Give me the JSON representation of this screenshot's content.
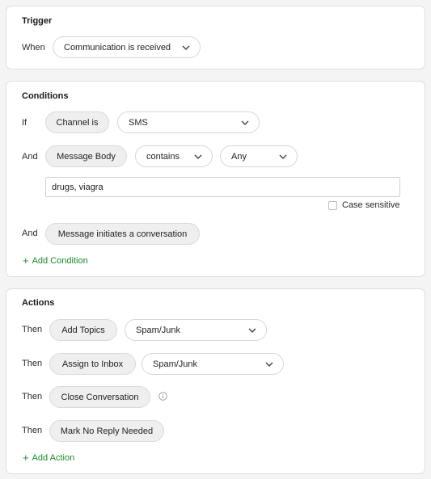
{
  "trigger": {
    "title": "Trigger",
    "when_label": "When",
    "event_value": "Communication is received"
  },
  "conditions": {
    "title": "Conditions",
    "rows": [
      {
        "label": "If",
        "field": "Channel is",
        "value": "SMS"
      },
      {
        "label": "And",
        "field": "Message Body",
        "operator": "contains",
        "value": "Any",
        "text_value": "drugs, viagra",
        "case_sensitive_label": "Case sensitive",
        "case_sensitive": false
      },
      {
        "label": "And",
        "field": "Message initiates a conversation"
      }
    ],
    "add_label": "Add Condition"
  },
  "actions": {
    "title": "Actions",
    "rows": [
      {
        "label": "Then",
        "action": "Add Topics",
        "value": "Spam/Junk"
      },
      {
        "label": "Then",
        "action": "Assign to Inbox",
        "value": "Spam/Junk"
      },
      {
        "label": "Then",
        "action": "Close Conversation",
        "icon": "info-icon"
      },
      {
        "label": "Then",
        "action": "Mark No Reply Needed"
      }
    ],
    "add_label": "Add Action"
  },
  "colors": {
    "accent_green": "#1c8a2d",
    "pill_bg": "#efefef",
    "card_border": "#dedede"
  }
}
